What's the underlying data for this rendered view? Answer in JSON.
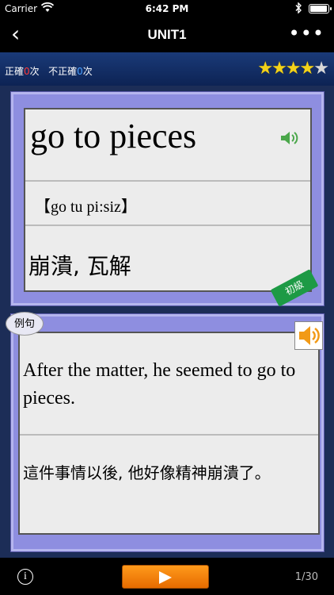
{
  "status": {
    "carrier": "Carrier",
    "time": "6:42 PM"
  },
  "nav": {
    "back_icon": "‹",
    "title": "UNIT1",
    "more_icon": "•••"
  },
  "stats": {
    "correct_label": "正確",
    "correct_count": "0",
    "incorrect_label": "不正確",
    "incorrect_count": "0",
    "times_unit": "次",
    "rating": 4,
    "rating_max": 5
  },
  "word_card": {
    "word": "go to pieces",
    "phonetic": "【go tu pi:siz】",
    "meaning": "崩潰, 瓦解",
    "level": "初級"
  },
  "example_card": {
    "tag": "例句",
    "sentence": "After the matter, he seemed to go to pieces.",
    "translation": "這件事情以後, 他好像精神崩潰了。"
  },
  "bottom": {
    "info_icon": "i",
    "page": "1/30"
  },
  "colors": {
    "card_border": "#8e8ee0",
    "card_inner": "#ececec",
    "accent_red": "#ff3838",
    "accent_blue": "#4aa0ff",
    "level_green": "#1d9a45",
    "play_orange": "#f58a10"
  }
}
